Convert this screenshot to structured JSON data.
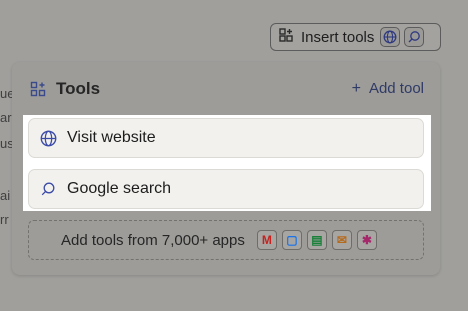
{
  "toolbar": {
    "insert_tools_label": "Insert tools",
    "globe_icon": "globe-icon",
    "search_icon": "search-icon"
  },
  "panel": {
    "title": "Tools",
    "add_tool_label": "Add tool",
    "add_tool_icon": "+",
    "tools": [
      {
        "label": "Visit website",
        "icon": "globe-icon"
      },
      {
        "label": "Google search",
        "icon": "search-icon"
      }
    ],
    "add_apps_label": "Add tools from 7,000+ apps",
    "apps": [
      {
        "name": "gmail-icon",
        "glyph": "M",
        "color": "#c5221f"
      },
      {
        "name": "google-calendar-icon",
        "glyph": "▢",
        "color": "#1a73e8"
      },
      {
        "name": "google-sheets-icon",
        "glyph": "▤",
        "color": "#188038"
      },
      {
        "name": "zapier-app-icon",
        "glyph": "✉",
        "color": "#b56a1c"
      },
      {
        "name": "slack-icon",
        "glyph": "✱",
        "color": "#a4286a"
      }
    ]
  },
  "background_text": {
    "line1": "ue",
    "line2": "ar",
    "line3": "us",
    "line4": "ai",
    "line5": "rr"
  },
  "colors": {
    "accent": "#3c4aa8",
    "overlay": "#8f8e8b",
    "row_bg": "#f2f1ed"
  }
}
